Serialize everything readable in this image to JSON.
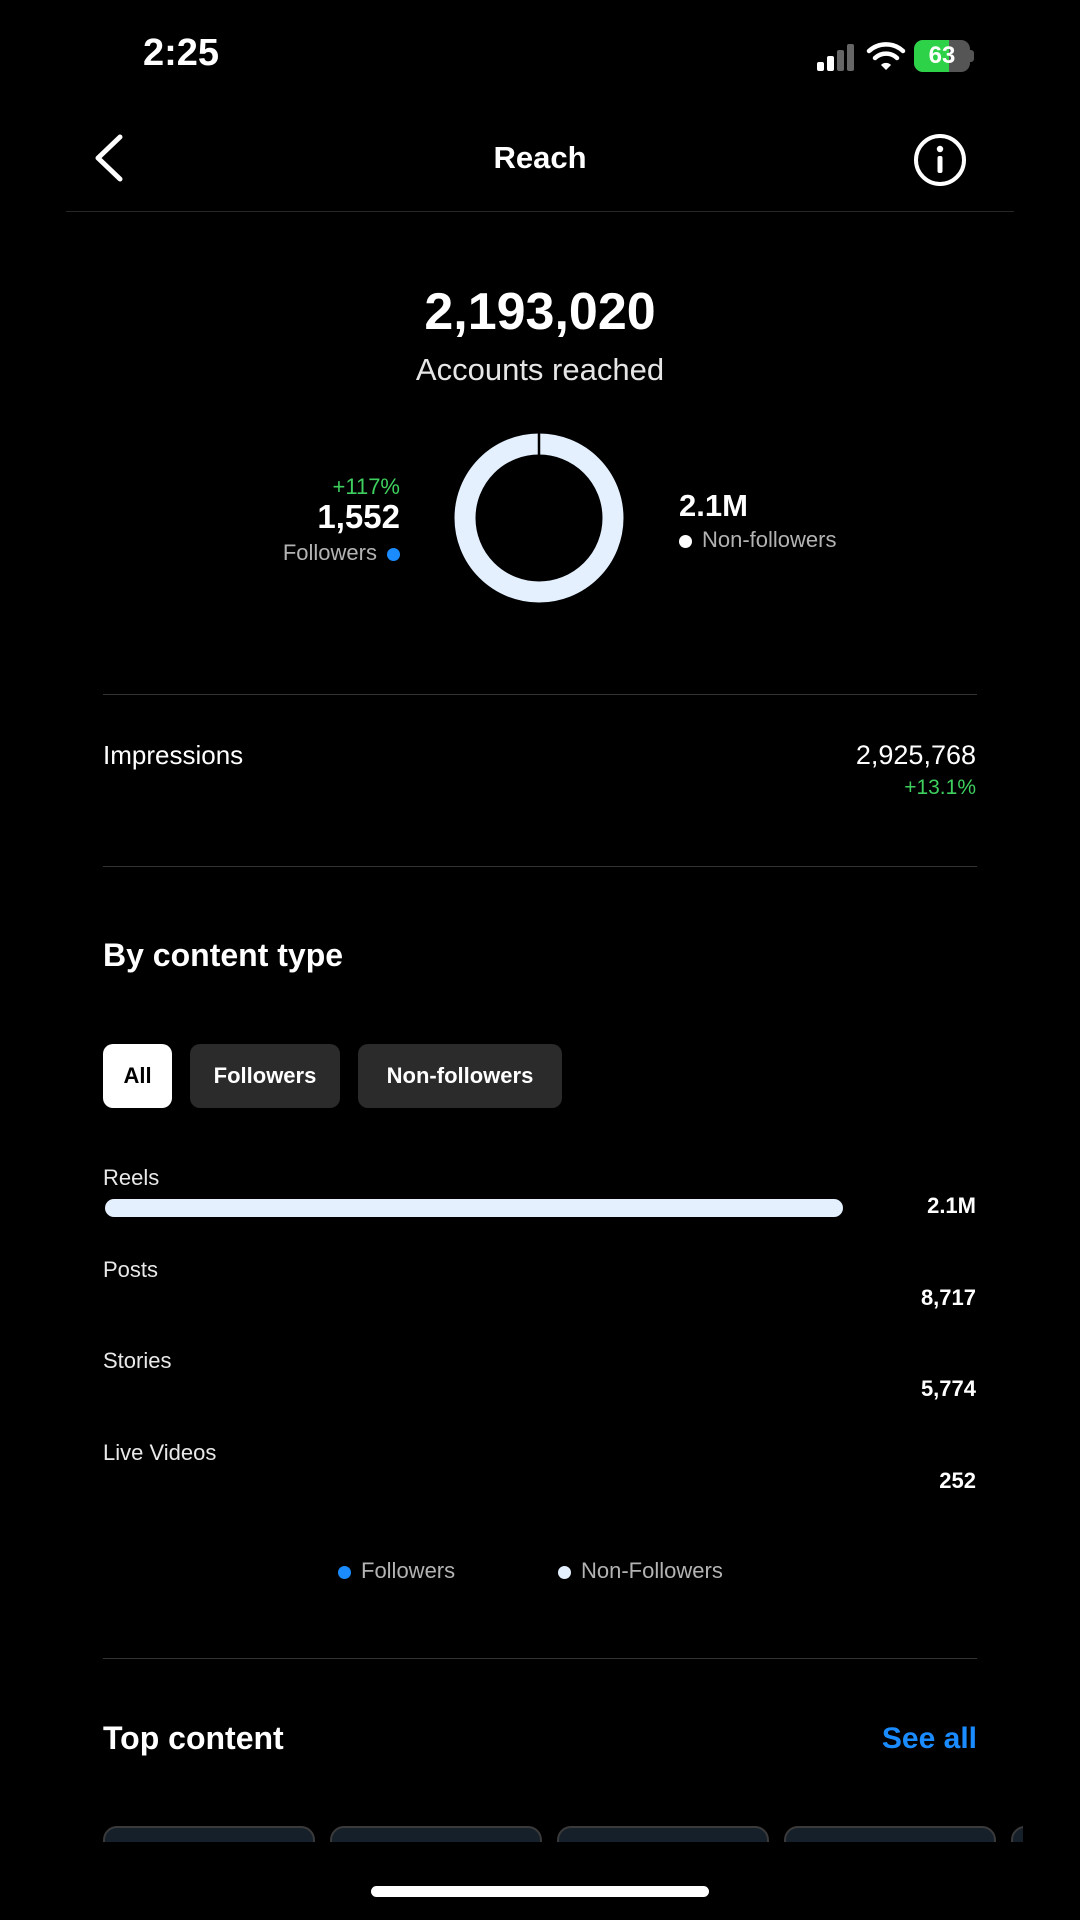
{
  "status_bar": {
    "time": "2:25",
    "battery": "63"
  },
  "header": {
    "title": "Reach"
  },
  "summary": {
    "accounts_reached": "2,193,020",
    "accounts_reached_label": "Accounts reached",
    "followers": {
      "change": "+117%",
      "value": "1,552",
      "label": "Followers"
    },
    "non_followers": {
      "value": "2.1M",
      "label": "Non-followers"
    },
    "donut_followers_fraction": 0.0007
  },
  "impressions": {
    "label": "Impressions",
    "value": "2,925,768",
    "change": "+13.1%"
  },
  "content_type": {
    "title": "By content type",
    "tabs": [
      "All",
      "Followers",
      "Non-followers"
    ],
    "selected_tab": "All",
    "rows": [
      {
        "label": "Reels",
        "value": "2.1M",
        "fraction": 1.0
      },
      {
        "label": "Posts",
        "value": "8,717",
        "fraction": 0.004
      },
      {
        "label": "Stories",
        "value": "5,774",
        "fraction": 0.003
      },
      {
        "label": "Live Videos",
        "value": "252",
        "fraction": 0.0001
      }
    ],
    "legend": [
      "Followers",
      "Non-Followers"
    ]
  },
  "top_content": {
    "title": "Top content",
    "see_all": "See all"
  },
  "colors": {
    "followers": "#1a8cff",
    "non_followers": "#e4f0fe",
    "positive": "#3ecf5e",
    "link": "#1a8cff"
  }
}
